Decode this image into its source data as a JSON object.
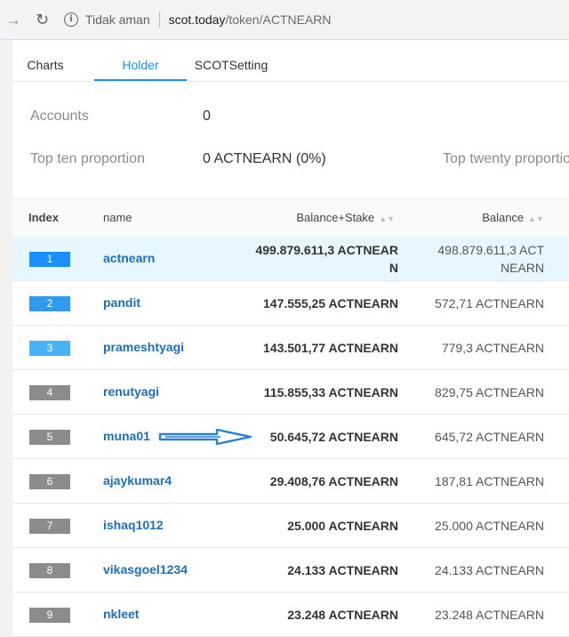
{
  "browser": {
    "security_label": "Tidak aman",
    "url_host": "scot.today",
    "url_path": "/token/ACTNEARN"
  },
  "tabs": [
    {
      "label": "Charts"
    },
    {
      "label": "Holder",
      "active": true
    },
    {
      "label": "SCOTSetting"
    }
  ],
  "stats": {
    "accounts_label": "Accounts",
    "accounts_value": "0",
    "top_ten_label": "Top ten proportion",
    "top_ten_value": "0 ACTNEARN (0%)",
    "top_twenty_label": "Top twenty proportio"
  },
  "table": {
    "columns": {
      "index": "Index",
      "name": "name",
      "balance_stake": "Balance+Stake",
      "balance": "Balance"
    },
    "rows": [
      {
        "index": "1",
        "name": "actnearn",
        "balance_stake": "499.879.611,3 ACTNEARN",
        "balance": "498.879.611,3 ACTNEARN"
      },
      {
        "index": "2",
        "name": "pandit",
        "balance_stake": "147.555,25 ACTNEARN",
        "balance": "572,71 ACTNEARN"
      },
      {
        "index": "3",
        "name": "prameshtyagi",
        "balance_stake": "143.501,77 ACTNEARN",
        "balance": "779,3 ACTNEARN"
      },
      {
        "index": "4",
        "name": "renutyagi",
        "balance_stake": "115.855,33 ACTNEARN",
        "balance": "829,75 ACTNEARN"
      },
      {
        "index": "5",
        "name": "muna01",
        "balance_stake": "50.645,72 ACTNEARN",
        "balance": "645,72 ACTNEARN"
      },
      {
        "index": "6",
        "name": "ajaykumar4",
        "balance_stake": "29.408,76 ACTNEARN",
        "balance": "187,81 ACTNEARN"
      },
      {
        "index": "7",
        "name": "ishaq1012",
        "balance_stake": "25.000 ACTNEARN",
        "balance": "25.000 ACTNEARN"
      },
      {
        "index": "8",
        "name": "vikasgoel1234",
        "balance_stake": "24.133 ACTNEARN",
        "balance": "24.133 ACTNEARN"
      },
      {
        "index": "9",
        "name": "nkleet",
        "balance_stake": "23.248 ACTNEARN",
        "balance": "23.248 ACTNEARN"
      }
    ]
  },
  "colors": {
    "rank_1": "#1890ff",
    "rank_2": "#2f9bf0",
    "rank_3": "#45b3f5",
    "rank_other": "#8c8c8c",
    "annotation_arrow": "#2a7fd4"
  }
}
